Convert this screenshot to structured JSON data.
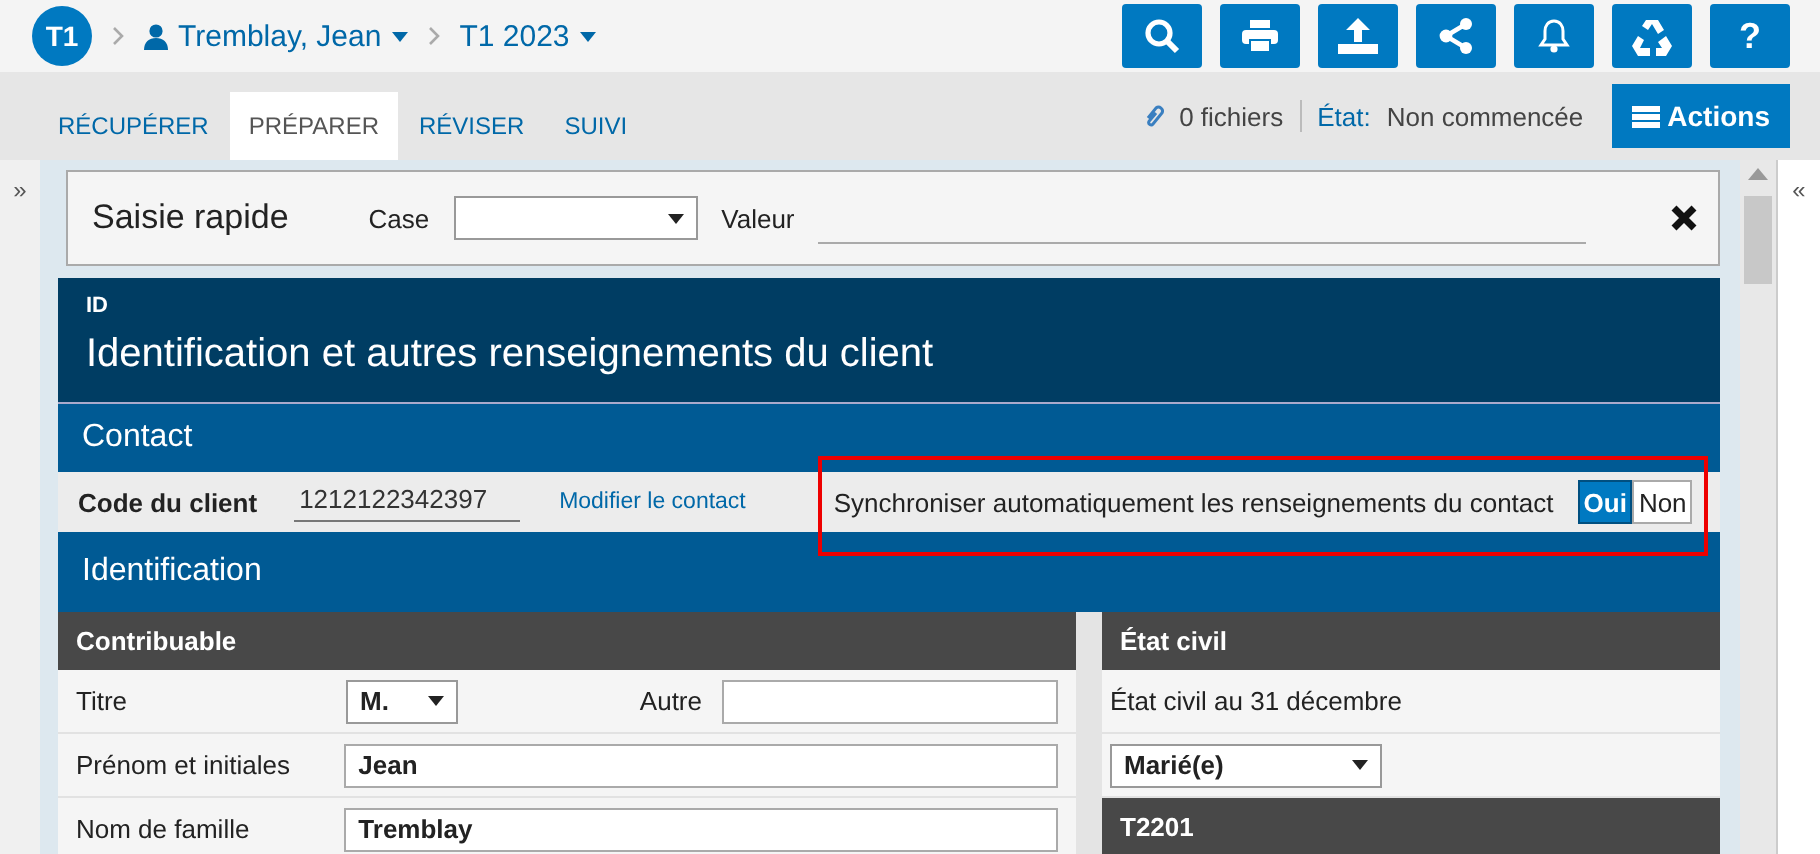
{
  "header": {
    "badge": "T1",
    "breadcrumbs": [
      {
        "kind": "client",
        "label": "Tremblay, Jean"
      },
      {
        "kind": "year",
        "label": "T1 2023"
      }
    ],
    "toolbar": [
      {
        "kind": "search"
      },
      {
        "kind": "print"
      },
      {
        "kind": "upload"
      },
      {
        "kind": "share"
      },
      {
        "kind": "bell"
      },
      {
        "kind": "recycle"
      },
      {
        "kind": "help",
        "label": "?"
      }
    ]
  },
  "tabs": [
    {
      "label": "RÉCUPÉRER",
      "selected": false
    },
    {
      "label": "PRÉPARER",
      "selected": true
    },
    {
      "label": "RÉVISER",
      "selected": false
    },
    {
      "label": "SUIVI",
      "selected": false
    }
  ],
  "status": {
    "files": "0 fichiers",
    "state_label": "État:",
    "state_value": "Non commencée",
    "actions": "Actions"
  },
  "side_left": "»",
  "side_right": "«",
  "quick_entry": {
    "title": "Saisie rapide",
    "case_label": "Case",
    "value_label": "Valeur"
  },
  "form": {
    "code": "ID",
    "title": "Identification et autres renseignements du client",
    "contact": {
      "heading": "Contact",
      "client_code_label": "Code du client",
      "client_code": "1212122342397",
      "edit_link": "Modifier le contact",
      "sync_label": "Synchroniser automatiquement les renseignements du contact",
      "highlighted": true,
      "sync_options": [
        {
          "label": "Oui",
          "selected": true
        },
        {
          "label": "Non",
          "selected": false
        }
      ]
    },
    "identification": {
      "heading": "Identification",
      "taxpayer": {
        "heading": "Contribuable",
        "title_label": "Titre",
        "title_value": "M.",
        "other_label": "Autre",
        "first_name_label": "Prénom et initiales",
        "first_name": "Jean",
        "last_name_label": "Nom de famille",
        "last_name": "Tremblay"
      },
      "marital": {
        "heading": "État civil",
        "question": "État civil au 31 décembre",
        "value": "Marié(e)",
        "next_heading": "T2201"
      }
    }
  }
}
